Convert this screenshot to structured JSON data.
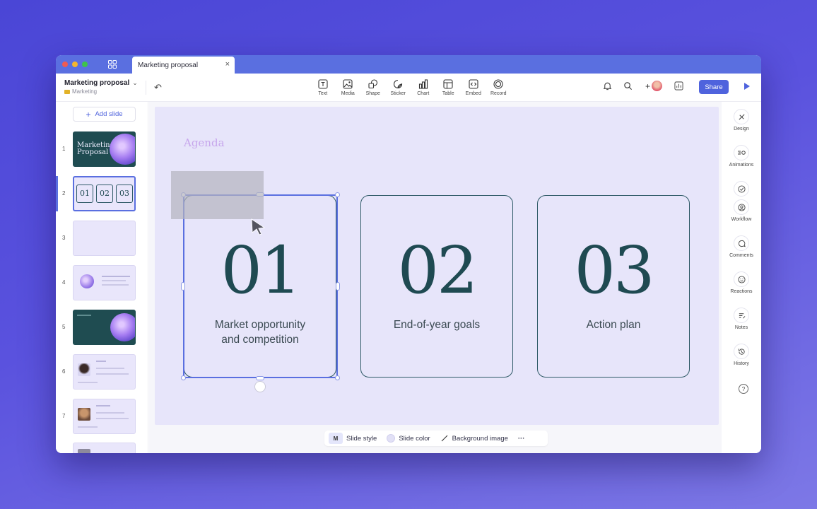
{
  "window": {
    "tab_title": "Marketing proposal",
    "close_glyph": "×",
    "traffic_lights": [
      "#ee5b52",
      "#f3b62e",
      "#3ec34b"
    ]
  },
  "toolbar": {
    "doc_title": "Marketing proposal",
    "doc_title_chevron": "⌄",
    "folder": "Marketing",
    "undo_glyph": "↶",
    "tools": [
      {
        "label": "Text",
        "icon": "text-icon"
      },
      {
        "label": "Media",
        "icon": "media-icon"
      },
      {
        "label": "Shape",
        "icon": "shape-icon"
      },
      {
        "label": "Sticker",
        "icon": "sticker-icon"
      },
      {
        "label": "Chart",
        "icon": "chart-icon"
      },
      {
        "label": "Table",
        "icon": "table-icon"
      },
      {
        "label": "Embed",
        "icon": "embed-icon"
      },
      {
        "label": "Record",
        "icon": "record-icon"
      }
    ],
    "share_label": "Share",
    "add_glyph": "+"
  },
  "left_panel": {
    "add_slide_label": "Add slide",
    "add_slide_glyph": "+",
    "slides": [
      {
        "num": "1",
        "title_line1": "Marketing",
        "title_line2": "Proposal"
      },
      {
        "num": "2",
        "items": [
          "01",
          "02",
          "03"
        ]
      },
      {
        "num": "3"
      },
      {
        "num": "4"
      },
      {
        "num": "5"
      },
      {
        "num": "6"
      },
      {
        "num": "7"
      }
    ],
    "active_slide": "2"
  },
  "slide": {
    "heading": "Agenda",
    "cards": [
      {
        "num": "01",
        "caption_line1": "Market opportunity",
        "caption_line2": "and competition"
      },
      {
        "num": "02",
        "caption_line1": "End-of-year goals",
        "caption_line2": ""
      },
      {
        "num": "03",
        "caption_line1": "Action plan",
        "caption_line2": ""
      }
    ]
  },
  "bottom_bar": {
    "style_badge": "M",
    "slide_style": "Slide style",
    "slide_color": "Slide color",
    "background_image": "Background image",
    "more": "···"
  },
  "right_panel": {
    "items": [
      {
        "label": "Design",
        "icon": "design-icon"
      },
      {
        "label": "Animations",
        "icon": "animations-icon"
      },
      {
        "label": "Workflow",
        "icon": "workflow-icon"
      },
      {
        "label": "Comments",
        "icon": "comments-icon"
      },
      {
        "label": "Reactions",
        "icon": "reactions-icon"
      },
      {
        "label": "Notes",
        "icon": "notes-icon"
      },
      {
        "label": "History",
        "icon": "history-icon"
      }
    ],
    "help_glyph": "?"
  },
  "colors": {
    "accent": "#4f63dd",
    "titlebar": "#5a6fe0",
    "card_border": "#2f5a67",
    "number_color": "#1f4a52",
    "agenda_color": "#c7a6ec",
    "slide_bg": "#e7e5fa"
  }
}
